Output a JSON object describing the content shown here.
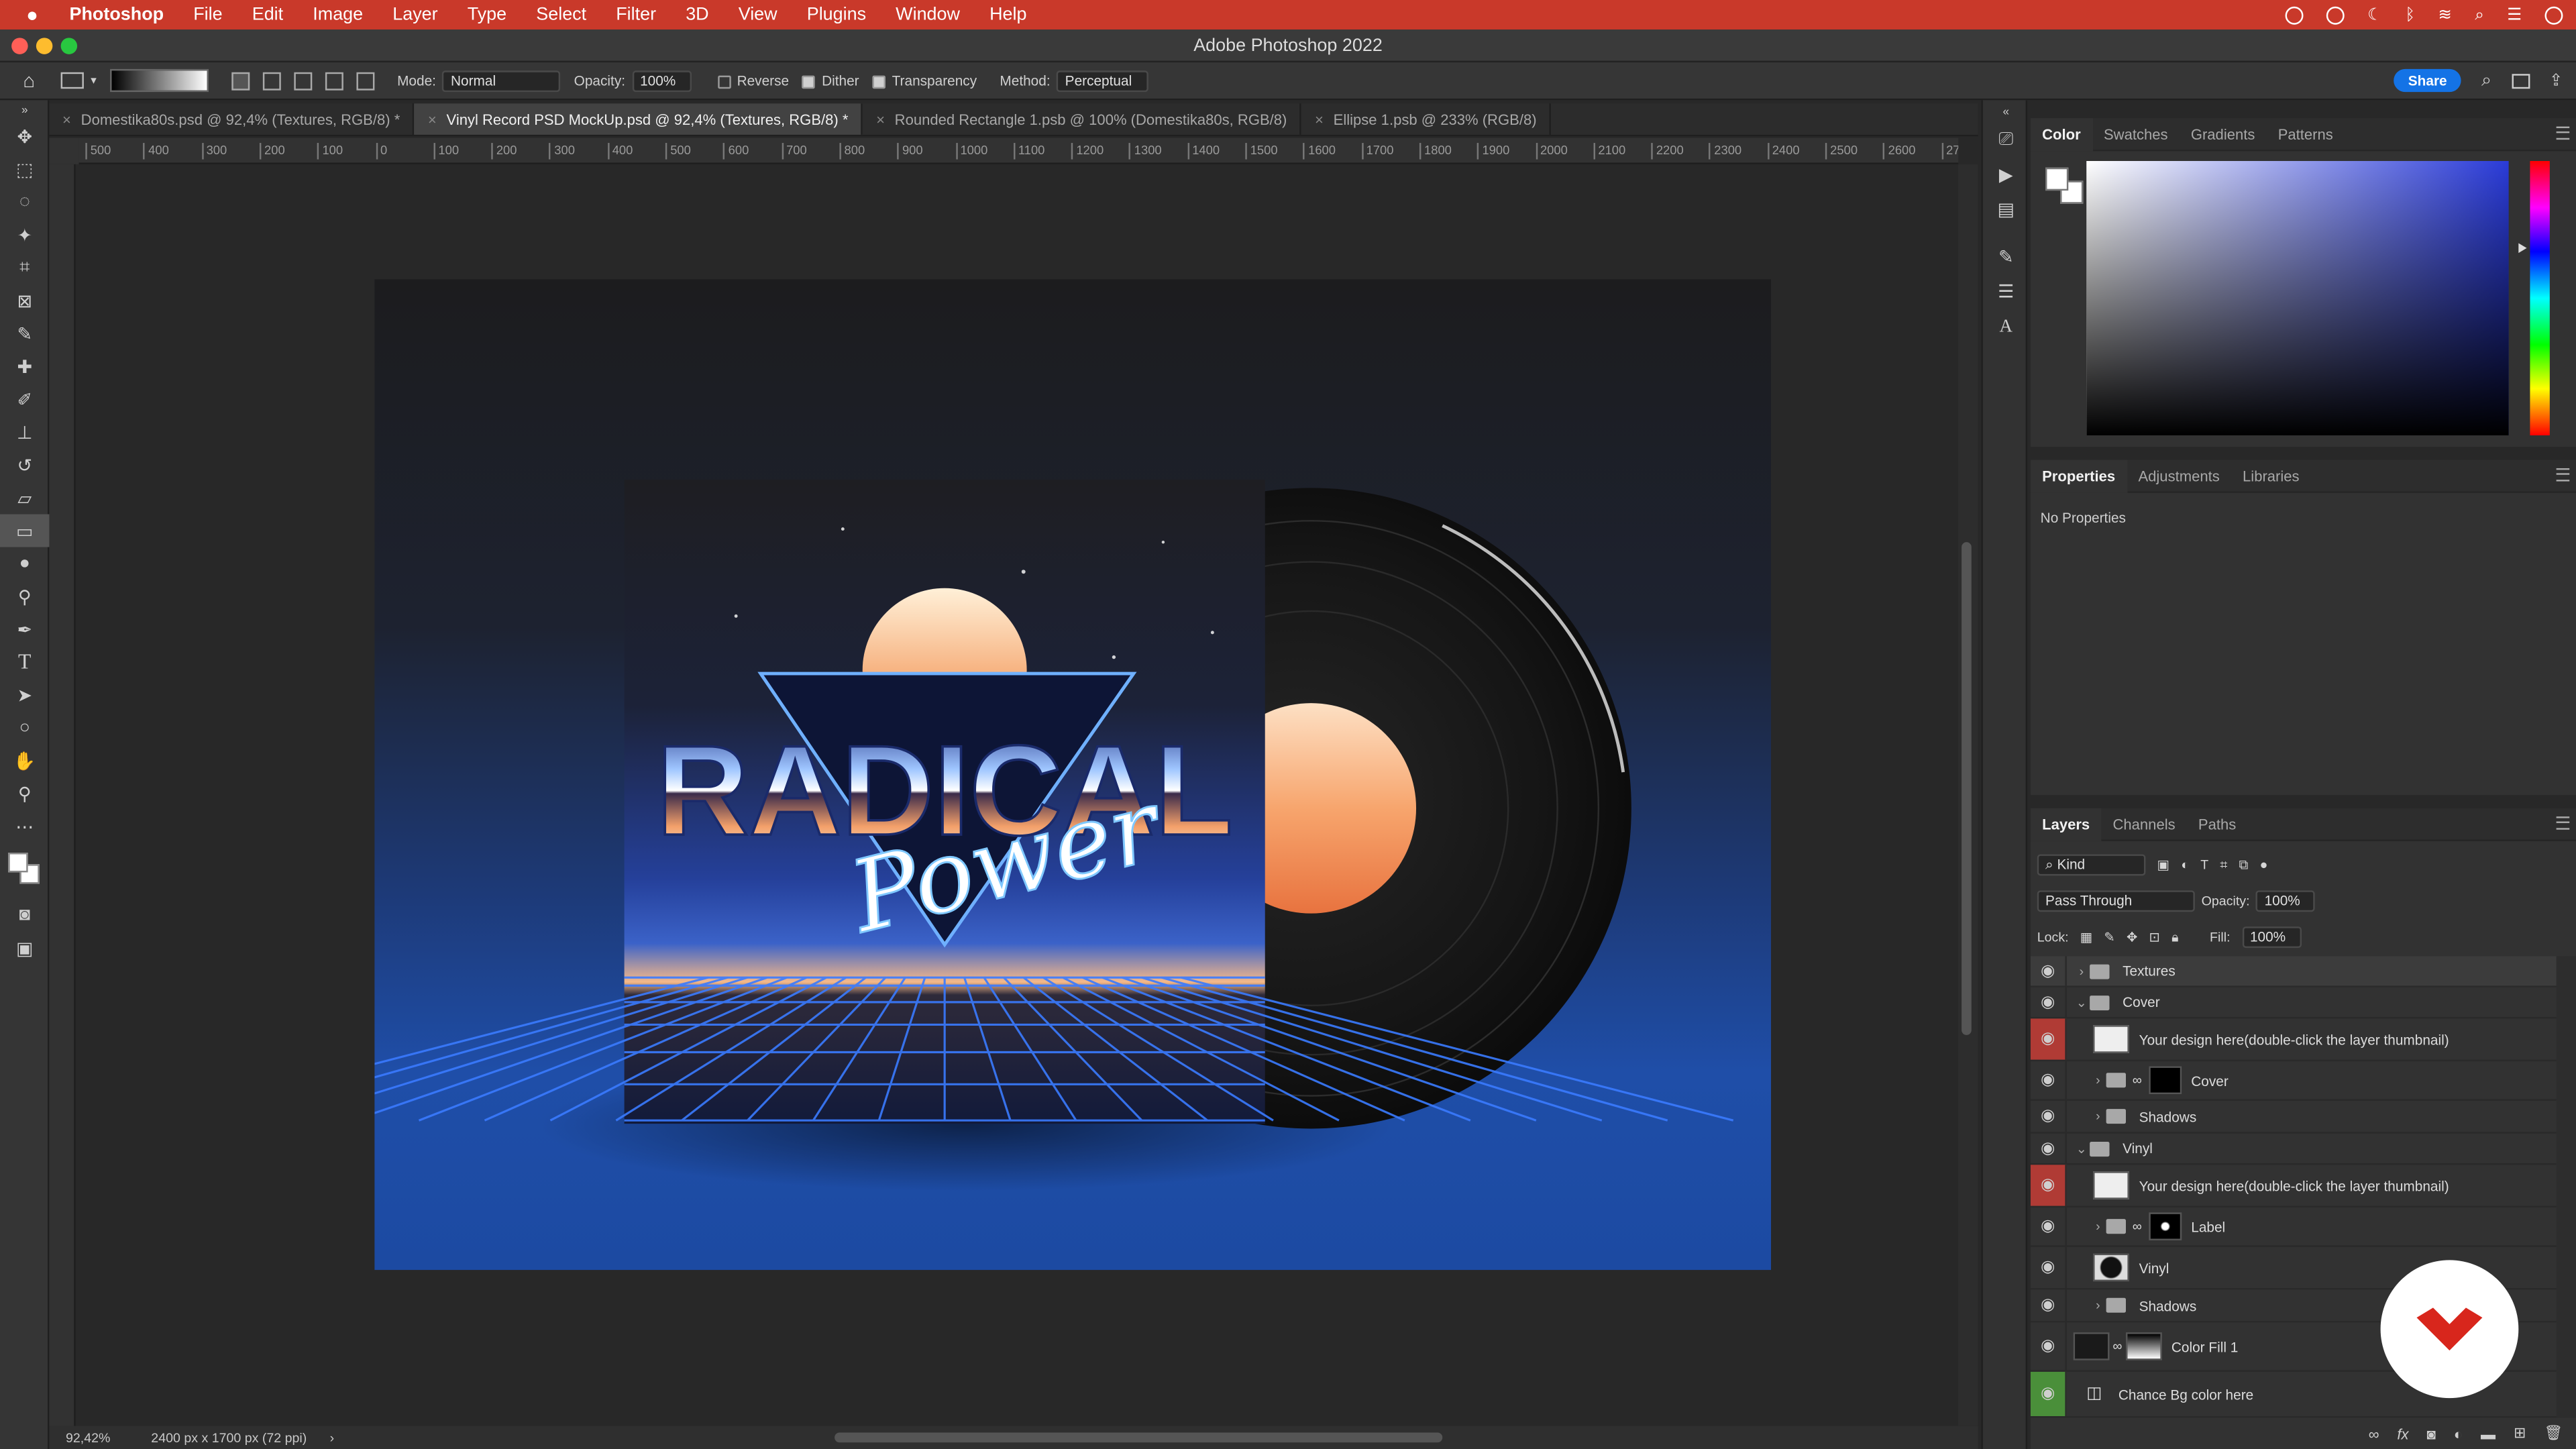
{
  "menubar": {
    "app_name": "Photoshop",
    "items": [
      "File",
      "Edit",
      "Image",
      "Layer",
      "Type",
      "Select",
      "Filter",
      "3D",
      "View",
      "Plugins",
      "Window",
      "Help"
    ]
  },
  "window": {
    "title": "Adobe Photoshop 2022"
  },
  "options": {
    "mode_label": "Mode:",
    "mode_value": "Normal",
    "opacity_label": "Opacity:",
    "opacity_value": "100%",
    "reverse_label": "Reverse",
    "dither_label": "Dither",
    "transparency_label": "Transparency",
    "method_label": "Method:",
    "method_value": "Perceptual",
    "share_label": "Share"
  },
  "tabs": [
    {
      "label": "Domestika80s.psd @ 92,4% (Textures, RGB/8) *"
    },
    {
      "label": "Vinyl Record PSD MockUp.psd @ 92,4% (Textures, RGB/8) *"
    },
    {
      "label": "Rounded Rectangle 1.psb @ 100% (Domestika80s, RGB/8)"
    },
    {
      "label": "Ellipse 1.psb @ 233% (RGB/8)"
    }
  ],
  "ruler": {
    "h_labels": [
      "500",
      "400",
      "300",
      "200",
      "100",
      "0",
      "100",
      "200",
      "300",
      "400",
      "500",
      "600",
      "700",
      "800",
      "900",
      "1000",
      "1100",
      "1200",
      "1300",
      "1400",
      "1500",
      "1600",
      "1700",
      "1800",
      "1900",
      "2000",
      "2100",
      "2200",
      "2300",
      "2400",
      "2500",
      "2600",
      "27"
    ]
  },
  "artwork": {
    "title_line1": "RADICAL",
    "title_line2": "Power"
  },
  "status": {
    "zoom": "92,42%",
    "doc_info": "2400 px x 1700 px (72 ppi)"
  },
  "color_panel": {
    "tabs": [
      "Color",
      "Swatches",
      "Gradients",
      "Patterns"
    ],
    "active_tab": "Color",
    "hue_color": "#2a3bd8"
  },
  "properties_panel": {
    "tabs": [
      "Properties",
      "Adjustments",
      "Libraries"
    ],
    "content": "No Properties"
  },
  "layers_panel": {
    "tabs": [
      "Layers",
      "Channels",
      "Paths"
    ],
    "filter_kind": "Kind",
    "blend_mode": "Pass Through",
    "opacity_label": "Opacity:",
    "opacity_value": "100%",
    "lock_label": "Lock:",
    "fill_label": "Fill:",
    "fill_value": "100%",
    "layers": [
      {
        "name": "Textures"
      },
      {
        "name": "Cover"
      },
      {
        "name": "Your design here(double-click the layer thumbnail)"
      },
      {
        "name": "Cover"
      },
      {
        "name": "Shadows"
      },
      {
        "name": "Vinyl"
      },
      {
        "name": "Your design here(double-click the layer thumbnail)"
      },
      {
        "name": "Label"
      },
      {
        "name": "Vinyl"
      },
      {
        "name": "Shadows"
      },
      {
        "name": "Color Fill 1"
      },
      {
        "name": "Chance Bg color here"
      }
    ]
  },
  "colors": {
    "menubar": "#c9392a",
    "accent_blue": "#1473e6",
    "eye_red": "#b03b35",
    "eye_green": "#4a8f3a",
    "logo_red": "#d8261c"
  }
}
